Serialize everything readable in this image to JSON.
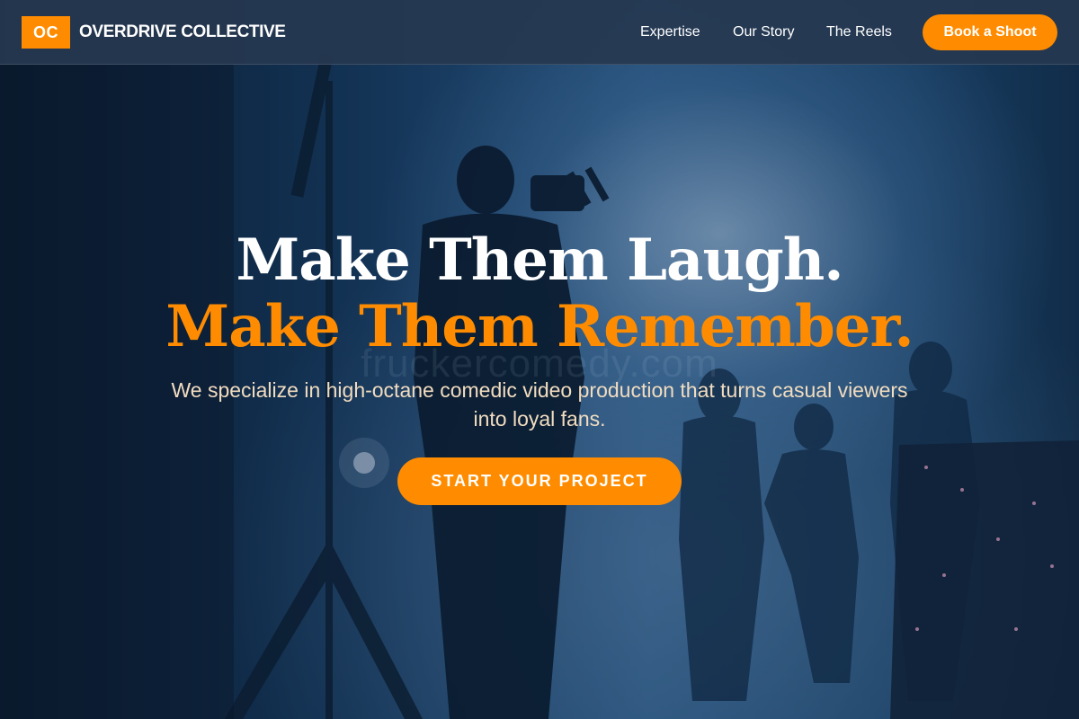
{
  "header": {
    "logo_badge": "OC",
    "brand_name": "OVERDRIVE COLLECTIVE",
    "nav": [
      {
        "label": "Expertise"
      },
      {
        "label": "Our Story"
      },
      {
        "label": "The Reels"
      }
    ],
    "cta_label": "Book a Shoot"
  },
  "hero": {
    "headline_line1": "Make Them Laugh.",
    "headline_line2": "Make Them Remember.",
    "watermark": "fruckercomedy.com",
    "subtitle": "We specialize in high-octane comedic video production that turns casual viewers into loyal fans.",
    "cta_label": "START YOUR PROJECT"
  },
  "colors": {
    "accent": "#ff8c00",
    "header_bg": "#263850",
    "text_light": "#ffffff",
    "subtitle_text": "#f1dcc0"
  }
}
